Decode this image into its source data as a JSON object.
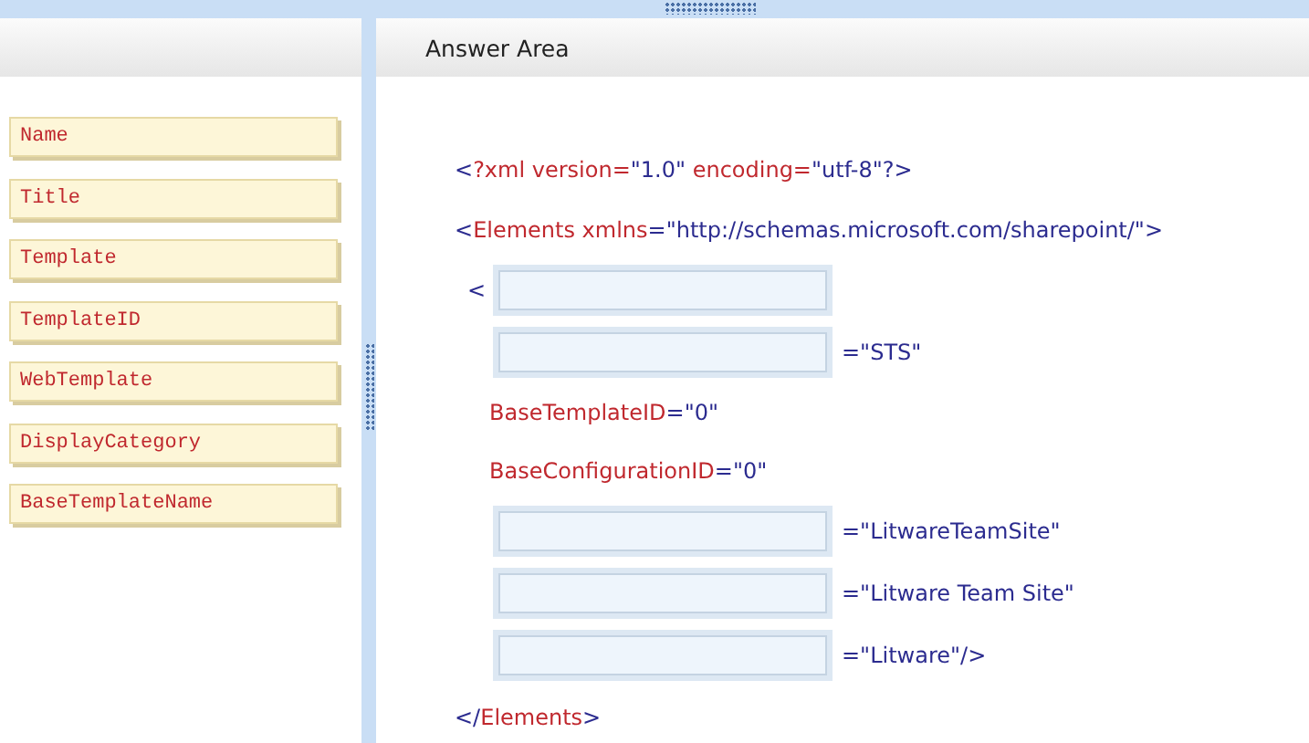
{
  "answer_area": {
    "title": "Answer Area"
  },
  "choices": [
    {
      "label": "Name"
    },
    {
      "label": "Title"
    },
    {
      "label": "Template"
    },
    {
      "label": "TemplateID"
    },
    {
      "label": "WebTemplate"
    },
    {
      "label": "DisplayCategory"
    },
    {
      "label": "BaseTemplateName"
    }
  ],
  "code_lines": [
    {
      "kind": "code",
      "segments": [
        {
          "kind": "punct",
          "text": "<"
        },
        {
          "kind": "name",
          "text": "?xml version="
        },
        {
          "kind": "value",
          "text": "\"1.0\""
        },
        {
          "kind": "name",
          "text": " encoding="
        },
        {
          "kind": "value",
          "text": "\"utf-8\"?>"
        }
      ]
    },
    {
      "kind": "code",
      "segments": [
        {
          "kind": "punct",
          "text": "<"
        },
        {
          "kind": "name",
          "text": "Elements xmlns"
        },
        {
          "kind": "value",
          "text": "=\"http://schemas.microsoft.com/sharepoint/\">"
        }
      ]
    },
    {
      "kind": "slot",
      "prefix": "<"
    },
    {
      "kind": "slot",
      "suffix": "=\"STS\""
    },
    {
      "kind": "attribute",
      "segments": [
        {
          "kind": "name",
          "text": "BaseTemplateID"
        },
        {
          "kind": "value",
          "text": "=\"0\""
        }
      ]
    },
    {
      "kind": "attribute",
      "segments": [
        {
          "kind": "name",
          "text": "BaseConfigurationID"
        },
        {
          "kind": "value",
          "text": "=\"0\""
        }
      ]
    },
    {
      "kind": "slot",
      "suffix": "=\"LitwareTeamSite\""
    },
    {
      "kind": "slot",
      "suffix": "=\"Litware Team Site\""
    },
    {
      "kind": "slot",
      "suffix": "=\"Litware\"/>"
    },
    {
      "kind": "code",
      "segments": [
        {
          "kind": "punct",
          "text": "</"
        },
        {
          "kind": "name",
          "text": "Elements"
        },
        {
          "kind": "punct",
          "text": ">"
        }
      ]
    }
  ]
}
